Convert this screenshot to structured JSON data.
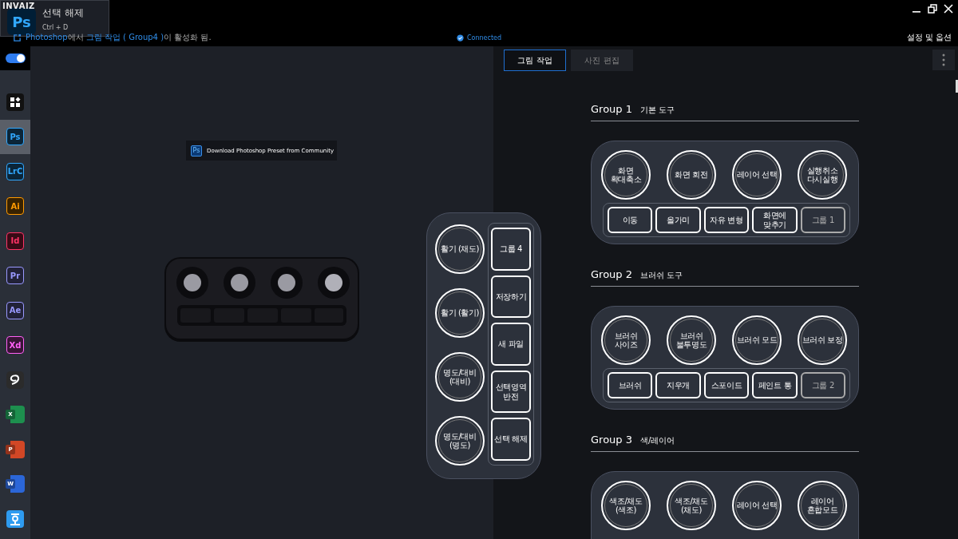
{
  "toast": {
    "brand": "INVAIZ",
    "app": "Ps",
    "title": "선택 해제",
    "shortcut": "Ctrl + D"
  },
  "status": {
    "parts": [
      {
        "text": "Photoshop",
        "highlight": true
      },
      {
        "text": "에서 ",
        "highlight": false
      },
      {
        "text": "그림 작업 ( Group4 )",
        "highlight": true
      },
      {
        "text": "이 활성화 됨.",
        "highlight": false
      }
    ]
  },
  "connection": {
    "label": "Connected",
    "connected": true
  },
  "settings_label": "설정 및 옵션",
  "power_toggle": {
    "on": true
  },
  "sidebar": {
    "items": [
      {
        "kind": "grid",
        "selected": false
      },
      {
        "kind": "adobe",
        "label": "Ps",
        "color": "#31a8ff",
        "selected": true
      },
      {
        "kind": "adobe",
        "label": "LrC",
        "color": "#31a8ff",
        "selected": false
      },
      {
        "kind": "adobe",
        "label": "Ai",
        "color": "#ff9a00",
        "selected": false
      },
      {
        "kind": "adobe",
        "label": "Id",
        "color": "#ff3366",
        "selected": false
      },
      {
        "kind": "adobe",
        "label": "Pr",
        "color": "#9999ff",
        "selected": false
      },
      {
        "kind": "adobe",
        "label": "Ae",
        "color": "#9999ff",
        "selected": false
      },
      {
        "kind": "adobe",
        "label": "Xd",
        "color": "#ff61f6",
        "selected": false
      },
      {
        "kind": "clip",
        "selected": false
      },
      {
        "kind": "office",
        "label": "X",
        "color": "#1d8f4e",
        "selected": false
      },
      {
        "kind": "office",
        "label": "P",
        "color": "#d24726",
        "selected": false
      },
      {
        "kind": "office",
        "label": "W",
        "color": "#2b66d8",
        "selected": false
      },
      {
        "kind": "hangul",
        "color": "#2e9bf0",
        "selected": false
      }
    ]
  },
  "preset_banner": {
    "app": "Ps",
    "label": "Download Photoshop Preset from Community"
  },
  "pad": {
    "dials": [
      "활기 (채도)",
      "활기 (활기)",
      "명도/대비\n(대비)",
      "명도/대비\n(명도)"
    ],
    "keys": [
      {
        "label": "그룹 4",
        "kind": "action"
      },
      {
        "label": "저장하기",
        "kind": "action"
      },
      {
        "label": "새 파일",
        "kind": "action"
      },
      {
        "label": "선택영역\n반전",
        "kind": "action"
      },
      {
        "label": "선택 해제",
        "kind": "action"
      }
    ]
  },
  "tabs": [
    {
      "label": "그림 작업",
      "selected": true
    },
    {
      "label": "사진 편집",
      "selected": false
    }
  ],
  "groups": [
    {
      "number": "Group 1",
      "name": "기본 도구",
      "dials": [
        "화면\n확대축소",
        "화면 회전",
        "레이어 선택",
        "실행취소\n다시실행"
      ],
      "keys": [
        {
          "label": "이동",
          "kind": "action"
        },
        {
          "label": "올가미",
          "kind": "action"
        },
        {
          "label": "자유 변형",
          "kind": "action"
        },
        {
          "label": "화면에\n맞추기",
          "kind": "action"
        },
        {
          "label": "그룹 1",
          "kind": "group"
        }
      ]
    },
    {
      "number": "Group 2",
      "name": "브러쉬 도구",
      "dials": [
        "브러쉬\n사이즈",
        "브러쉬\n불투명도",
        "브러쉬 모드",
        "브러쉬 보정"
      ],
      "keys": [
        {
          "label": "브러쉬",
          "kind": "action"
        },
        {
          "label": "지우개",
          "kind": "action"
        },
        {
          "label": "스포이드",
          "kind": "action"
        },
        {
          "label": "페인트 통",
          "kind": "action"
        },
        {
          "label": "그룹 2",
          "kind": "group"
        }
      ]
    },
    {
      "number": "Group 3",
      "name": "색/레이어",
      "dials": [
        "색조/채도\n(색조)",
        "색조/채도\n(채도)",
        "레이어 선택",
        "레이어\n혼합모드"
      ]
    }
  ]
}
